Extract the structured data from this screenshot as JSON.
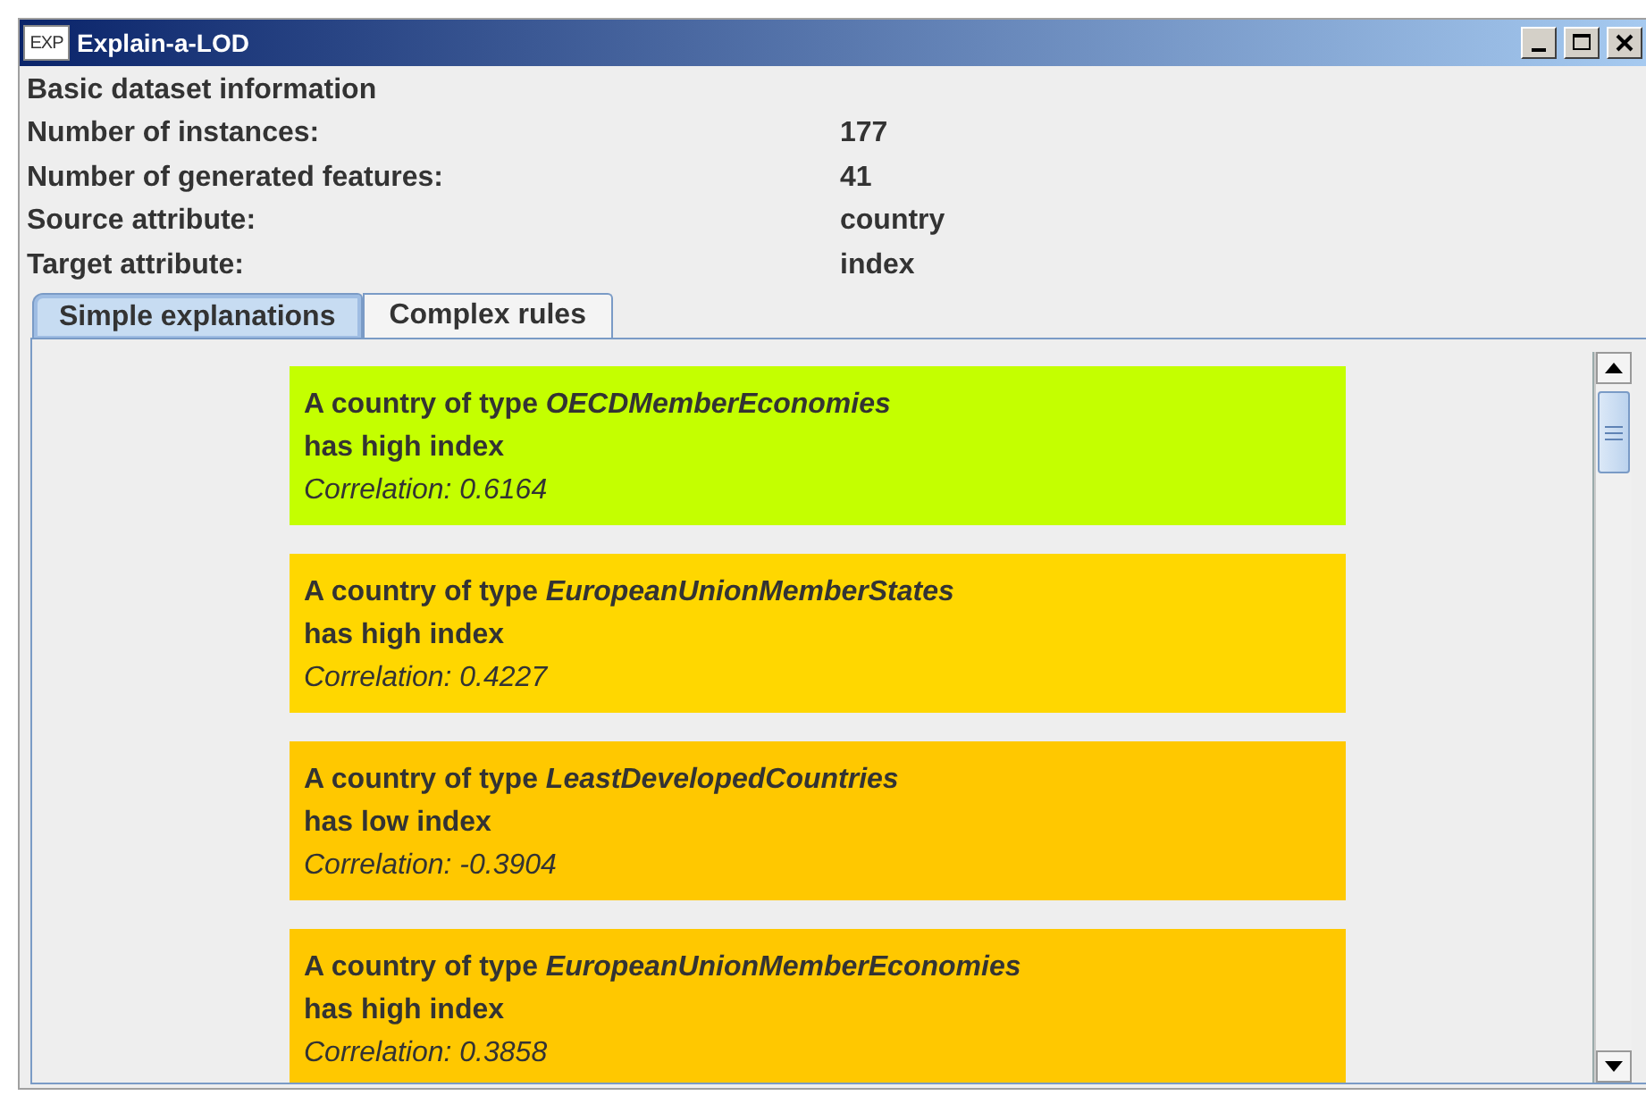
{
  "window": {
    "icon_text": "EXP",
    "title": "Explain-a-LOD"
  },
  "info": {
    "heading": "Basic dataset information",
    "rows": [
      {
        "label": "Number of instances:",
        "value": "177"
      },
      {
        "label": "Number of generated features:",
        "value": "41"
      },
      {
        "label": "Source attribute:",
        "value": "country"
      },
      {
        "label": "Target attribute:",
        "value": "index"
      }
    ]
  },
  "tabs": [
    {
      "label": "Simple explanations",
      "selected": true
    },
    {
      "label": "Complex rules",
      "selected": false
    }
  ],
  "explanations": [
    {
      "title": "A country of type *OECDMemberEconomies*",
      "statement": "has high index",
      "correlation": "Correlation: 0.6164",
      "color": "#c4ff00"
    },
    {
      "title": "A country of type *EuropeanUnionMemberStates*",
      "statement": "has high index",
      "correlation": "Correlation: 0.4227",
      "color": "#ffd700"
    },
    {
      "title": "A country of type *LeastDevelopedCountries*",
      "statement": "has low index",
      "correlation": "Correlation: -0.3904",
      "color": "#ffc800"
    },
    {
      "title": "A country of type *EuropeanUnionMemberEconomies*",
      "statement": "has high index",
      "correlation": "Correlation: 0.3858",
      "color": "#ffc800"
    }
  ]
}
